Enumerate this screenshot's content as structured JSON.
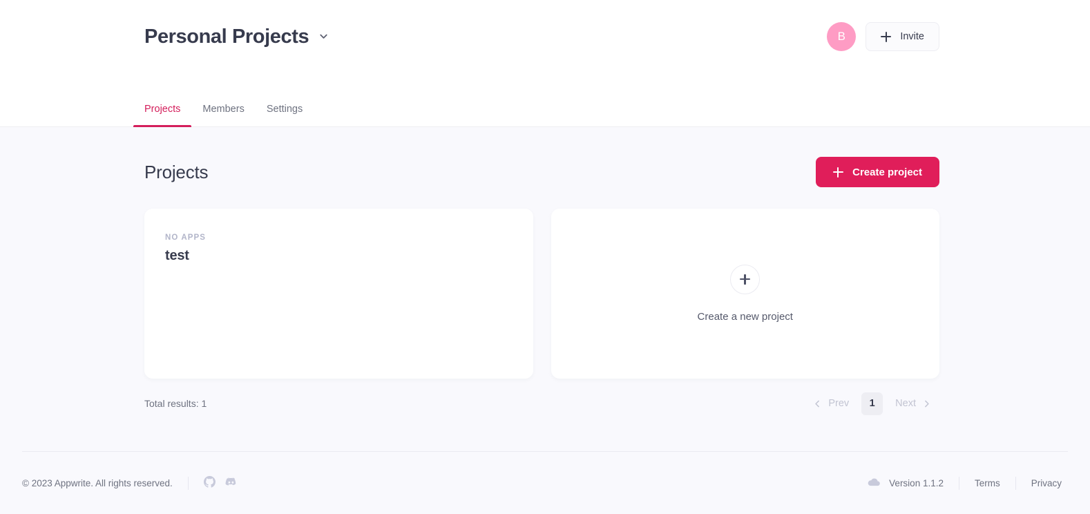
{
  "header": {
    "org_title": "Personal Projects",
    "chevron_icon": "chevron-down-icon",
    "avatar_initial": "B",
    "avatar_color": "#fe9cc4",
    "invite_label": "Invite",
    "invite_icon": "plus-icon",
    "tabs": [
      {
        "label": "Projects",
        "active": true
      },
      {
        "label": "Members",
        "active": false
      },
      {
        "label": "Settings",
        "active": false
      }
    ],
    "active_tab_color": "#d41e5b"
  },
  "main": {
    "section_title": "Projects",
    "create_project_label": "Create project",
    "create_project_icon": "plus-icon",
    "create_project_color": "#e01e5a",
    "projects": [
      {
        "eyebrow": "NO APPS",
        "name": "test"
      }
    ],
    "new_project": {
      "icon": "plus-icon",
      "label": "Create a new project"
    }
  },
  "pagination": {
    "total_results": "Total results: 1",
    "prev_label": "Prev",
    "prev_icon": "chevron-left-icon",
    "next_label": "Next",
    "next_icon": "chevron-right-icon",
    "pages": [
      "1"
    ],
    "current_page": "1"
  },
  "footer": {
    "copyright": "© 2023 Appwrite. All rights reserved.",
    "social": [
      {
        "name": "github-icon"
      },
      {
        "name": "discord-icon"
      }
    ],
    "version": "Version 1.1.2",
    "version_icon": "cloud-icon",
    "terms_label": "Terms",
    "privacy_label": "Privacy"
  }
}
